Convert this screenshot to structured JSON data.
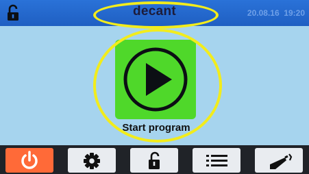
{
  "header": {
    "title": "decant",
    "datetime": "20.08.16  19:20",
    "lock_icon": "padlock-open-icon"
  },
  "main": {
    "start_label": "Start program",
    "play_icon": "play-icon"
  },
  "toolbar": {
    "items": [
      {
        "icon": "power-icon"
      },
      {
        "icon": "gear-icon"
      },
      {
        "icon": "padlock-open-icon"
      },
      {
        "icon": "list-icon"
      },
      {
        "icon": "decant-bottle-icon"
      }
    ]
  },
  "colors": {
    "header": "#1f5fc2",
    "background": "#a6d4ee",
    "start_tile": "#4fd82a",
    "power_button": "#ff6a38",
    "annotation": "#f2ec1c"
  }
}
